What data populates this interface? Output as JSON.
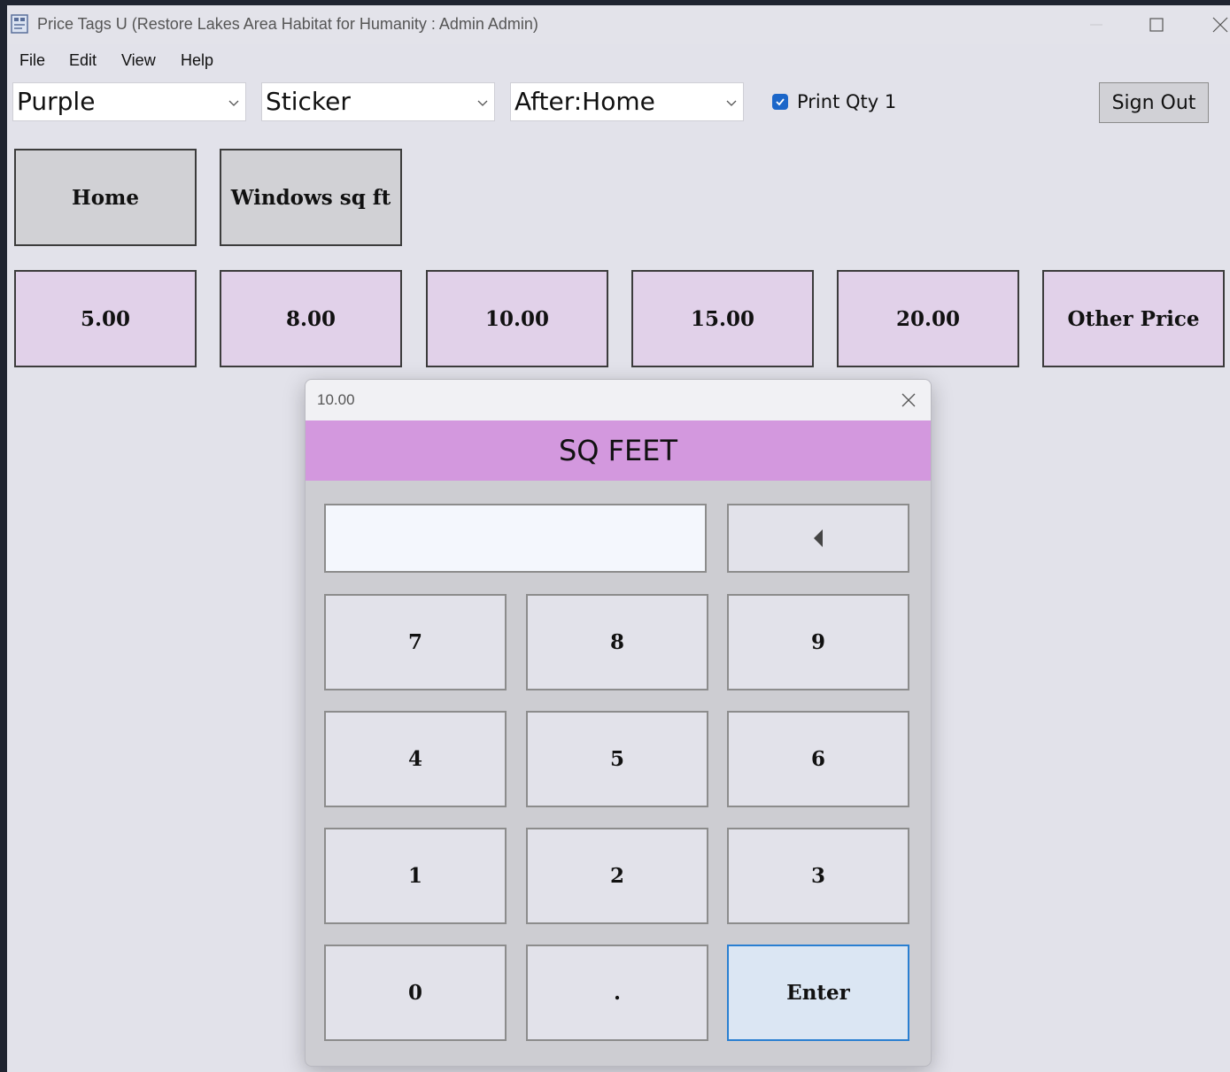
{
  "window": {
    "title": "Price Tags U  (Restore Lakes Area Habitat for Humanity : Admin Admin)",
    "icons": {
      "app": "app-icon",
      "minimize": "minimize-icon",
      "maximize": "maximize-icon",
      "close": "close-icon"
    }
  },
  "menu": [
    "File",
    "Edit",
    "View",
    "Help"
  ],
  "toolbar": {
    "color_select": "Purple",
    "tag_type_select": "Sticker",
    "after_select": "After:Home",
    "print_qty_label": "Print Qty 1",
    "print_qty_checked": true,
    "sign_out_label": "Sign Out"
  },
  "categories": [
    "Home",
    "Windows sq ft"
  ],
  "prices": [
    "5.00",
    "8.00",
    "10.00",
    "15.00",
    "20.00",
    "Other Price"
  ],
  "dialog": {
    "title": "10.00",
    "header": "SQ FEET",
    "entry_value": "",
    "backspace_icon": "backspace-arrow-icon",
    "keys": [
      "7",
      "8",
      "9",
      "4",
      "5",
      "6",
      "1",
      "2",
      "3",
      "0",
      ".",
      "Enter"
    ]
  },
  "colors": {
    "window_bg": "#e2e2ea",
    "category_tile": "#d1d1d5",
    "price_tile": "#e1d1e9",
    "dialog_header": "#d398de",
    "enter_key": "#dbe6f3",
    "checkbox_accent": "#1b66c9"
  }
}
